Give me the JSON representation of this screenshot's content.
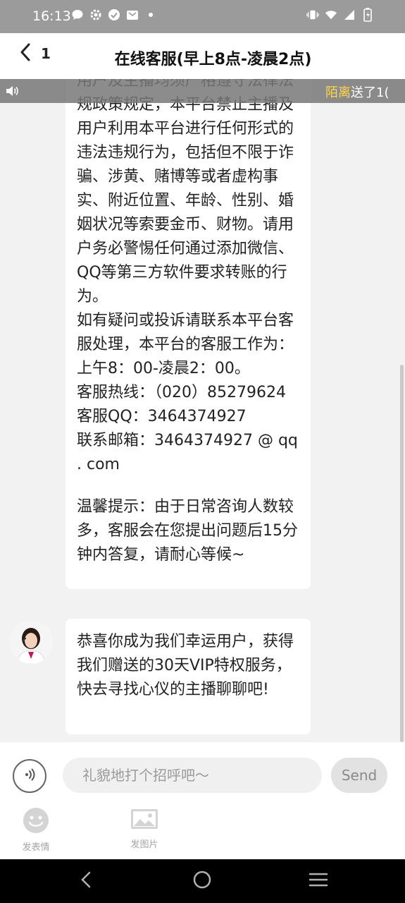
{
  "status_bar": {
    "time": "16:13",
    "left_icons": [
      "chat-bubble-icon",
      "gear-icon",
      "check-circle-icon",
      "mail-icon",
      "dot-icon"
    ],
    "right_icons": [
      "vibrate-icon",
      "wifi-icon",
      "signal-icon",
      "battery-charging-icon"
    ]
  },
  "header": {
    "back_count": "1",
    "title": "在线客服(早上8点-凌晨2点)"
  },
  "banner": {
    "name": "陌离",
    "suffix": "送了1("
  },
  "messages": {
    "first": {
      "text": "用户及主播均须严格遵守法律法规政策规定，本平台禁止主播及用户利用本平台进行任何形式的违法违规行为，包括但不限于诈骗、涉黄、赌博等或者虚构事实、附近位置、年龄、性别、婚姻状况等索要金币、财物。请用户务必警惕任何通过添加微信、QQ等第三方软件要求转账的行为。",
      "contact": "如有疑问或投诉请联系本平台客服处理，本平台的客服工作为：上午8：00-凌晨2：00。",
      "hotline": "客服热线：（020）85279624",
      "qq": "客服QQ：3464374927",
      "email": "联系邮箱：3464374927 @ qq . com",
      "tip": "温馨提示：由于日常咨询人数较多，客服会在您提出问题后15分钟内答复，请耐心等候~"
    },
    "second": {
      "text": "恭喜你成为我们幸运用户，获得我们赠送的30天VIP特权服务，快去寻找心仪的主播聊聊吧!"
    }
  },
  "input": {
    "placeholder": "礼貌地打个招呼吧～",
    "send_label": "Send"
  },
  "tools": {
    "emoji_label": "发表情",
    "image_label": "发图片"
  },
  "colors": {
    "banner_name": "#ffd54a",
    "send_bg": "#e2e2e2"
  }
}
